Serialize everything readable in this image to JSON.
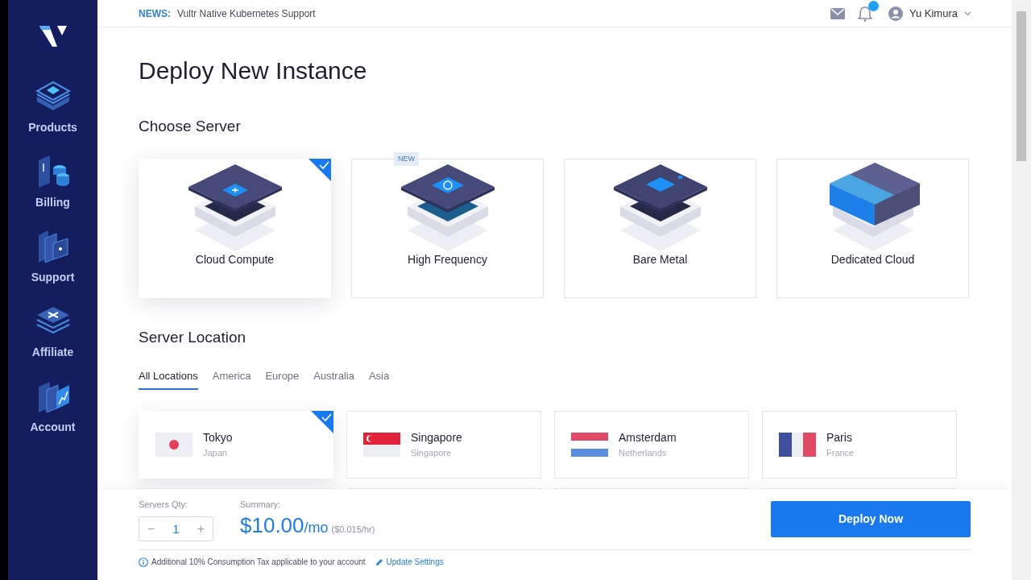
{
  "sidebar": {
    "items": [
      {
        "label": "Products",
        "kind": "products"
      },
      {
        "label": "Billing",
        "kind": "billing"
      },
      {
        "label": "Support",
        "kind": "support"
      },
      {
        "label": "Affiliate",
        "kind": "affiliate"
      },
      {
        "label": "Account",
        "kind": "account"
      }
    ]
  },
  "topbar": {
    "news_label": "NEWS:",
    "news_text": "Vultr Native Kubernetes Support",
    "notifications_badge": true,
    "user_name": "Yu Kimura"
  },
  "page_title": "Deploy New Instance",
  "choose_server": {
    "heading": "Choose Server",
    "servers": [
      {
        "name": "Cloud Compute",
        "kind": "compute",
        "selected": true
      },
      {
        "name": "High Frequency",
        "kind": "frequency",
        "selected": false,
        "badge": "NEW"
      },
      {
        "name": "Bare Metal",
        "kind": "metal",
        "selected": false
      },
      {
        "name": "Dedicated Cloud",
        "kind": "dedicated",
        "selected": false
      }
    ]
  },
  "server_location": {
    "heading": "Server Location",
    "tabs": [
      {
        "label": "All Locations",
        "selected": true
      },
      {
        "label": "America",
        "selected": false
      },
      {
        "label": "Europe",
        "selected": false
      },
      {
        "label": "Australia",
        "selected": false
      },
      {
        "label": "Asia",
        "selected": false
      }
    ],
    "locations": [
      {
        "city": "Tokyo",
        "country": "Japan",
        "kind": "japan",
        "selected": true
      },
      {
        "city": "Singapore",
        "country": "Singapore",
        "kind": "singapore",
        "selected": false
      },
      {
        "city": "Amsterdam",
        "country": "Netherlands",
        "kind": "netherlands",
        "selected": false
      },
      {
        "city": "Paris",
        "country": "France",
        "kind": "france",
        "selected": false
      }
    ]
  },
  "footer": {
    "qty_label": "Servers Qty:",
    "qty_minus": "−",
    "qty_value": "1",
    "qty_plus": "+",
    "summary_label": "Summary:",
    "price": "$10.00",
    "price_unit": "/mo",
    "price_hourly": "($0.015/hr)",
    "deploy_button": "Deploy Now",
    "tax_note": "Additional 10% Consumption Tax applicable to your account",
    "update_link": "Update Settings"
  }
}
